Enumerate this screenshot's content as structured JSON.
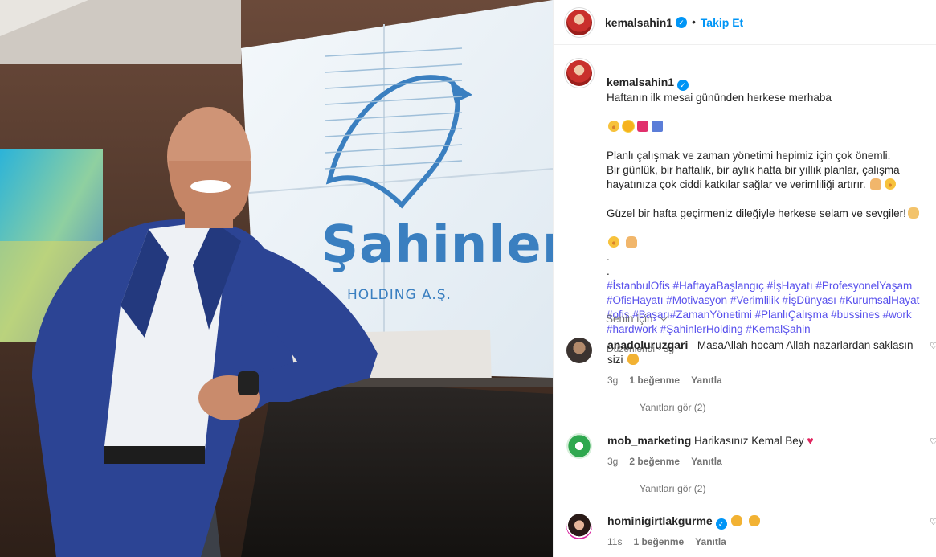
{
  "header": {
    "username": "kemalsahin1",
    "dot": "•",
    "follow_label": "Takip Et"
  },
  "photo": {
    "logo_text": "Şahinler",
    "logo_sub": "HOLDING A.Ş."
  },
  "caption": {
    "username": "kemalsahin1",
    "line1": "Haftanın ilk mesai gününden herkese merhaba",
    "para2": "Planlı çalışmak ve zaman yönetimi hepimiz için çok önemli.\nBir günlük, bir haftalık, bir aylık hatta bir yıllık planlar, çalışma\nhayatınıza çok ciddi katkılar sağlar ve verimliliği artırır.",
    "para3": "Güzel bir hafta geçirmeniz dileğiyle herkese selam ve sevgiler!",
    "dot1": ".",
    "dot2": ".",
    "hashtags": "#İstanbulOfis #HaftayaBaşlangıç #İşHayatı #ProfesyonelYaşam #OfisHayatı #Motivasyon #Verimlilik #İşDünyası #KurumsalHayat #ofis #Başarı#ZamanYönetimi #PlanlıÇalışma #bussines #work #hardwork #ŞahinlerHolding #KemalŞahin",
    "meta": "Düzenlendi · 3g"
  },
  "for_you": "Senin için",
  "comments": [
    {
      "username": "anadoluruzgari_",
      "text": "MasaAllah hocam Allah nazarlardan saklasın sizi",
      "time": "3g",
      "likes": "1 beğenme",
      "reply": "Yanıtla",
      "view_replies": "Yanıtları gör (2)"
    },
    {
      "username": "mob_marketing",
      "text": "Harikasınız Kemal Bey",
      "time": "3g",
      "likes": "2 beğenme",
      "reply": "Yanıtla",
      "view_replies": "Yanıtları gör (2)"
    },
    {
      "username": "hominigirtlakgurme",
      "text": "",
      "time": "11s",
      "likes": "1 beğenme",
      "reply": "Yanıtla"
    }
  ],
  "colors": {
    "link": "#0095f6",
    "hashtag": "#5850ec",
    "muted": "#737373",
    "verified": "#0095f6"
  }
}
